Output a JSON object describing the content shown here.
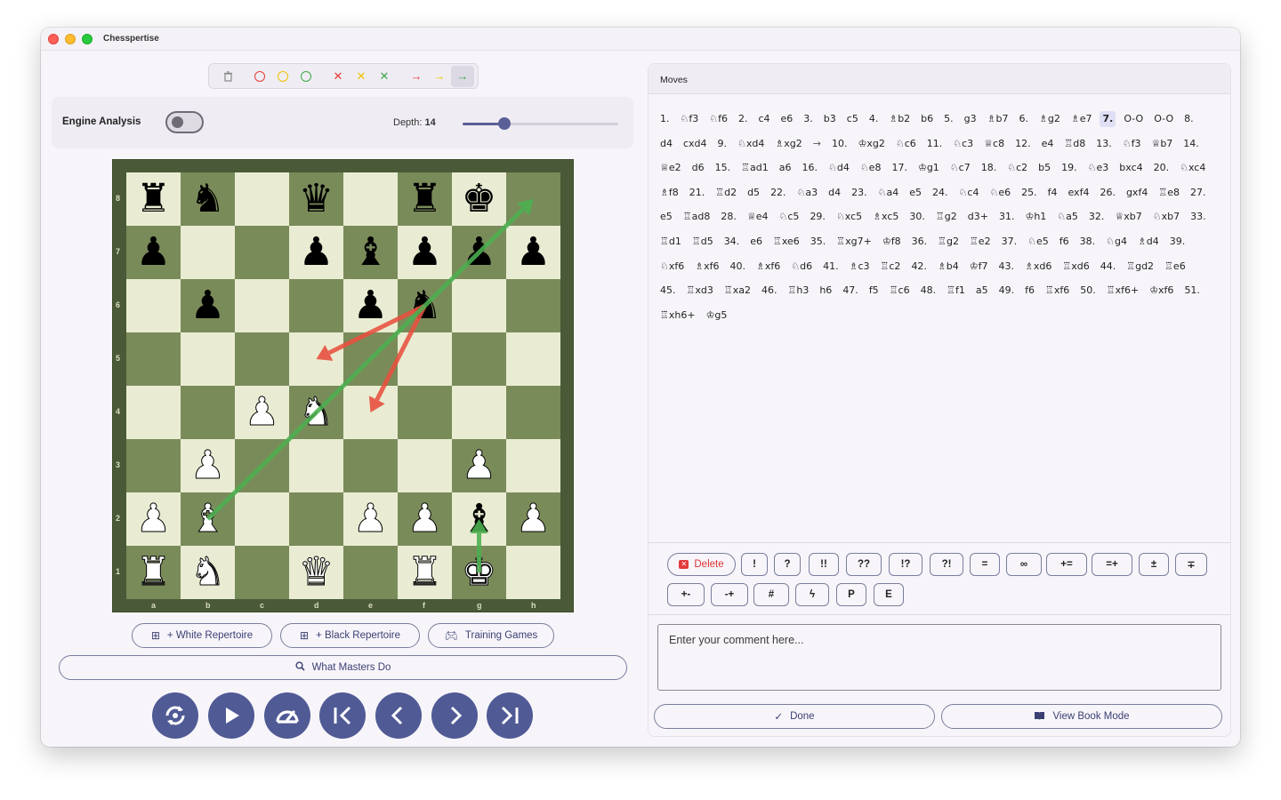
{
  "app": {
    "title": "Chesspertise"
  },
  "annotation_colors": {
    "red": "#e53935",
    "yellow": "#f2c100",
    "green": "#3aa84b"
  },
  "engine": {
    "label": "Engine Analysis",
    "enabled": false,
    "depth_label": "Depth:",
    "depth": "14",
    "depth_fraction": 0.27
  },
  "board": {
    "files": [
      "a",
      "b",
      "c",
      "d",
      "e",
      "f",
      "g",
      "h"
    ],
    "ranks": [
      "8",
      "7",
      "6",
      "5",
      "4",
      "3",
      "2",
      "1"
    ],
    "rows": [
      [
        "bR",
        "bN",
        "",
        "bQ",
        "",
        "bR",
        "bK",
        ""
      ],
      [
        "bP",
        "",
        "",
        "bP",
        "bB",
        "bP",
        "bP",
        "bP"
      ],
      [
        "",
        "bP",
        "",
        "",
        "bP",
        "bN",
        "",
        ""
      ],
      [
        "",
        "",
        "",
        "",
        "",
        "",
        "",
        ""
      ],
      [
        "",
        "",
        "wP",
        "wN",
        "",
        "",
        "",
        ""
      ],
      [
        "",
        "wP",
        "",
        "",
        "",
        "",
        "wP",
        ""
      ],
      [
        "wP",
        "wB",
        "",
        "",
        "wP",
        "wP",
        "bB",
        "wP"
      ],
      [
        "wR",
        "wN",
        "",
        "wQ",
        "",
        "wR",
        "wK",
        ""
      ]
    ],
    "arrows": [
      {
        "from": "f6",
        "to": "d5",
        "color": "red"
      },
      {
        "from": "f6",
        "to": "e4",
        "color": "red"
      },
      {
        "from": "b2",
        "to": "h8",
        "color": "green"
      },
      {
        "from": "g1",
        "to": "g2",
        "color": "green"
      }
    ]
  },
  "repertoire": {
    "white": "+ White Repertoire",
    "black": "+ Black Repertoire",
    "training": "Training Games",
    "masters": "What Masters Do"
  },
  "moves_panel": {
    "title": "Moves",
    "current_index": 18,
    "moves": [
      "1.",
      "♘f3",
      "♘f6",
      "2.",
      "c4",
      "e6",
      "3.",
      "b3",
      "c5",
      "4.",
      "♗b2",
      "b6",
      "5.",
      "g3",
      "♗b7",
      "6.",
      "♗g2",
      "♗e7",
      "7.",
      "O-O",
      "O-O",
      "8.",
      "d4",
      "cxd4",
      "9.",
      "♘xd4",
      "♗xg2",
      "→",
      "10.",
      "♔xg2",
      "♘c6",
      "11.",
      "♘c3",
      "♕c8",
      "12.",
      "e4",
      "♖d8",
      "13.",
      "♘f3",
      "♕b7",
      "14.",
      "♕e2",
      "d6",
      "15.",
      "♖ad1",
      "a6",
      "16.",
      "♘d4",
      "♘e8",
      "17.",
      "♔g1",
      "♘c7",
      "18.",
      "♘c2",
      "b5",
      "19.",
      "♘e3",
      "bxc4",
      "20.",
      "♘xc4",
      "♗f8",
      "21.",
      "♖d2",
      "d5",
      "22.",
      "♘a3",
      "d4",
      "23.",
      "♘a4",
      "e5",
      "24.",
      "♘c4",
      "♘e6",
      "25.",
      "f4",
      "exf4",
      "26.",
      "gxf4",
      "♖e8",
      "27.",
      "e5",
      "♖ad8",
      "28.",
      "♕e4",
      "♘c5",
      "29.",
      "♘xc5",
      "♗xc5",
      "30.",
      "♖g2",
      "d3+",
      "31.",
      "♔h1",
      "♘a5",
      "32.",
      "♕xb7",
      "♘xb7",
      "33.",
      "♖d1",
      "♖d5",
      "34.",
      "e6",
      "♖xe6",
      "35.",
      "♖xg7+",
      "♔f8",
      "36.",
      "♖g2",
      "♖e2",
      "37.",
      "♘e5",
      "f6",
      "38.",
      "♘g4",
      "♗d4",
      "39.",
      "♘xf6",
      "♗xf6",
      "40.",
      "♗xf6",
      "♘d6",
      "41.",
      "♗c3",
      "♖c2",
      "42.",
      "♗b4",
      "♔f7",
      "43.",
      "♗xd6",
      "♖xd6",
      "44.",
      "♖gd2",
      "♖e6",
      "45.",
      "♖xd3",
      "♖xa2",
      "46.",
      "♖h3",
      "h6",
      "47.",
      "f5",
      "♖c6",
      "48.",
      "♖f1",
      "a5",
      "49.",
      "f6",
      "♖xf6",
      "50.",
      "♖xf6+",
      "♔xf6",
      "51.",
      "♖xh6+",
      "♔g5"
    ]
  },
  "nags": {
    "delete_label": "Delete",
    "row1": [
      "!",
      "?",
      "!!",
      "??",
      "!?",
      "?!",
      "=",
      "∞",
      "+=",
      "=+",
      "±",
      "∓"
    ],
    "row2": [
      "+-",
      "-+",
      "#",
      "ϟ",
      "P",
      "E"
    ]
  },
  "comment": {
    "placeholder": "Enter your comment here..."
  },
  "actions": {
    "done": "Done",
    "book_mode": "View Book Mode"
  }
}
